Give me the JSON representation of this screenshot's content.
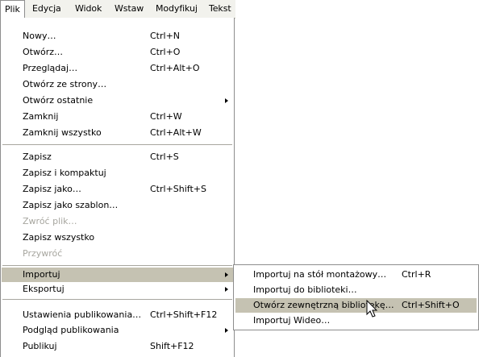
{
  "menubar": {
    "items": [
      {
        "label": "Plik"
      },
      {
        "label": "Edycja"
      },
      {
        "label": "Widok"
      },
      {
        "label": "Wstaw"
      },
      {
        "label": "Modyfikuj"
      },
      {
        "label": "Tekst"
      }
    ]
  },
  "file_menu": {
    "items": [
      {
        "label": "Nowy…",
        "shortcut": "Ctrl+N"
      },
      {
        "label": "Otwórz…",
        "shortcut": "Ctrl+O"
      },
      {
        "label": "Przeglądaj…",
        "shortcut": "Ctrl+Alt+O"
      },
      {
        "label": "Otwórz ze strony…",
        "shortcut": ""
      },
      {
        "label": "Otwórz ostatnie",
        "shortcut": ""
      },
      {
        "label": "Zamknij",
        "shortcut": "Ctrl+W"
      },
      {
        "label": "Zamknij wszystko",
        "shortcut": "Ctrl+Alt+W"
      },
      {
        "label": "Zapisz",
        "shortcut": "Ctrl+S"
      },
      {
        "label": "Zapisz i kompaktuj",
        "shortcut": ""
      },
      {
        "label": "Zapisz jako…",
        "shortcut": "Ctrl+Shift+S"
      },
      {
        "label": "Zapisz jako szablon…",
        "shortcut": ""
      },
      {
        "label": "Zwróć plik…",
        "shortcut": ""
      },
      {
        "label": "Zapisz wszystko",
        "shortcut": ""
      },
      {
        "label": "Przywróć",
        "shortcut": ""
      },
      {
        "label": "Importuj",
        "shortcut": ""
      },
      {
        "label": "Eksportuj",
        "shortcut": ""
      },
      {
        "label": "Ustawienia publikowania…",
        "shortcut": "Ctrl+Shift+F12"
      },
      {
        "label": "Podgląd publikowania",
        "shortcut": ""
      },
      {
        "label": "Publikuj",
        "shortcut": "Shift+F12"
      }
    ]
  },
  "import_submenu": {
    "items": [
      {
        "label": "Importuj na stół montażowy…",
        "shortcut": "Ctrl+R"
      },
      {
        "label": "Importuj do biblioteki…",
        "shortcut": ""
      },
      {
        "label": "Otwórz zewnętrzną bibliotekę…",
        "shortcut": "Ctrl+Shift+O"
      },
      {
        "label": "Importuj Wideo…",
        "shortcut": ""
      }
    ]
  },
  "colors": {
    "menubar_bg": "#f2f2ed",
    "highlight": "#c5c2b2",
    "disabled_text": "#a7a69f",
    "border": "#8d8d8d"
  }
}
